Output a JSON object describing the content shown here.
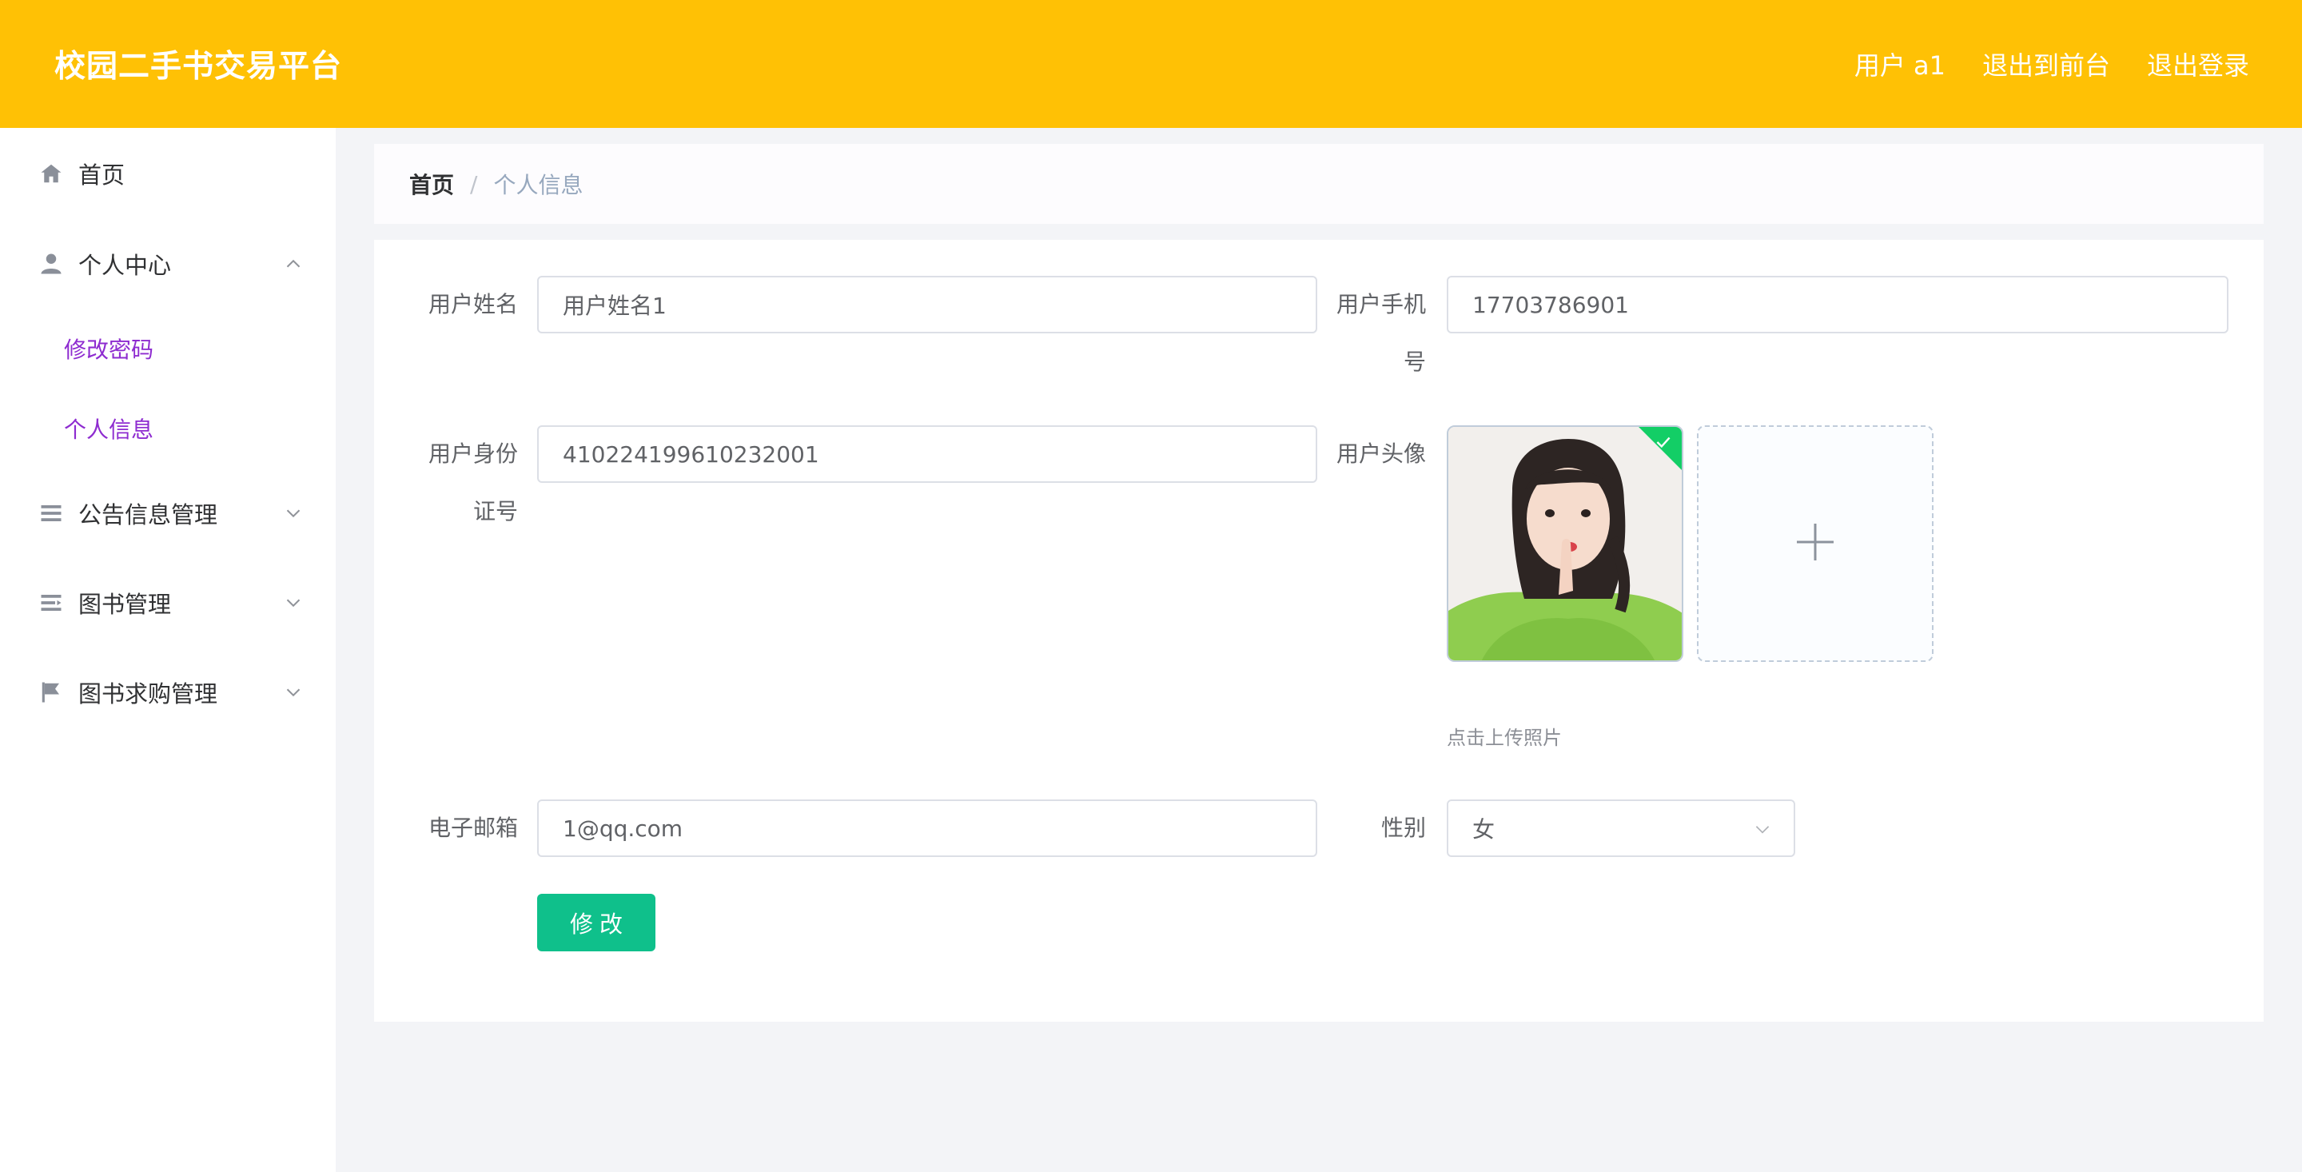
{
  "header": {
    "title": "校园二手书交易平台",
    "user_label": "用户 a1",
    "exit_front": "退出到前台",
    "logout": "退出登录"
  },
  "sidebar": {
    "items": [
      {
        "label": "首页",
        "icon": "home-icon"
      },
      {
        "label": "个人中心",
        "icon": "user-icon",
        "expanded": true,
        "children": [
          {
            "label": "修改密码"
          },
          {
            "label": "个人信息"
          }
        ]
      },
      {
        "label": "公告信息管理",
        "icon": "list-icon"
      },
      {
        "label": "图书管理",
        "icon": "menu-lines-icon"
      },
      {
        "label": "图书求购管理",
        "icon": "flag-icon"
      }
    ]
  },
  "breadcrumb": {
    "home": "首页",
    "separator": "/",
    "current": "个人信息"
  },
  "form": {
    "name_label": "用户姓名",
    "name_value": "用户姓名1",
    "phone_label_line1": "用户手机",
    "phone_label_line2": "号",
    "phone_value": "17703786901",
    "idcard_label_line1": "用户身份",
    "idcard_label_line2": "证号",
    "idcard_value": "410224199610232001",
    "avatar_label": "用户头像",
    "upload_hint": "点击上传照片",
    "email_label": "电子邮箱",
    "email_value": "1@qq.com",
    "gender_label": "性别",
    "gender_value": "女",
    "submit_label": "修改"
  },
  "colors": {
    "header_bg": "#ffc105",
    "submenu_active": "#8e2cd0",
    "submit_bg": "#0fc08b",
    "upload_success": "#13ce66"
  }
}
